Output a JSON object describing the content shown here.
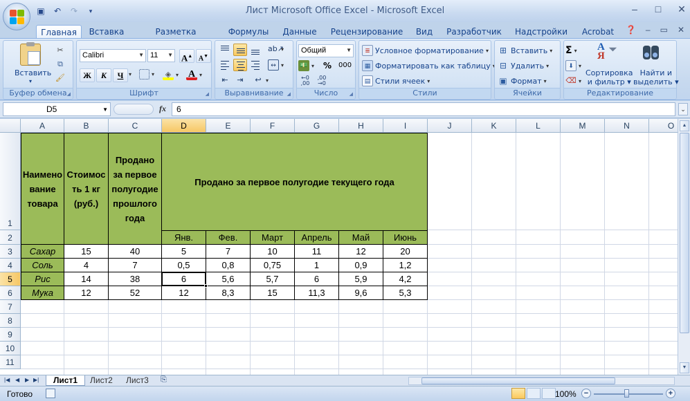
{
  "window": {
    "title": "Лист Microsoft Office Excel - Microsoft Excel",
    "controls": [
      "–",
      "□",
      "✕"
    ]
  },
  "quick_access": [
    {
      "icon": "save-icon",
      "glyph": "💾"
    },
    {
      "icon": "undo-icon",
      "glyph": "↶"
    },
    {
      "icon": "redo-icon",
      "glyph": "↷"
    },
    {
      "icon": "customize-qat-icon",
      "glyph": "▾"
    }
  ],
  "tabs": [
    "Главная",
    "Вставка",
    "Разметка страницы",
    "Формулы",
    "Данные",
    "Рецензирование",
    "Вид",
    "Разработчик",
    "Надстройки",
    "Acrobat"
  ],
  "active_tab": "Главная",
  "ribbon": {
    "clipboard": {
      "label": "Буфер обмена",
      "paste": "Вставить"
    },
    "font": {
      "label": "Шрифт",
      "font_name": "Calibri",
      "font_size": "11",
      "bold": "Ж",
      "italic": "К",
      "underline": "Ч",
      "grow": "A",
      "shrink": "A"
    },
    "alignment": {
      "label": "Выравнивание"
    },
    "number": {
      "label": "Число",
      "format": "Общий",
      "percent": "%",
      "thousands": "000"
    },
    "styles": {
      "label": "Стили",
      "conditional": "Условное форматирование",
      "as_table": "Форматировать как таблицу",
      "cell_styles": "Стили ячеек"
    },
    "cells": {
      "label": "Ячейки",
      "insert": "Вставить",
      "delete": "Удалить",
      "format": "Формат"
    },
    "editing": {
      "label": "Редактирование",
      "sigma": "Σ",
      "sort1": "Сортировка",
      "sort2": "и фильтр",
      "find1": "Найти и",
      "find2": "выделить"
    }
  },
  "formula_bar": {
    "name_box": "D5",
    "fx": "fx",
    "value": "6"
  },
  "columns": [
    "A",
    "B",
    "C",
    "D",
    "E",
    "F",
    "G",
    "H",
    "I",
    "J",
    "K",
    "L",
    "M",
    "N",
    "O"
  ],
  "rows": [
    "1",
    "2",
    "3",
    "4",
    "5",
    "6",
    "7",
    "8",
    "9",
    "10",
    "11"
  ],
  "selected_cell": {
    "col": "D",
    "row": "5"
  },
  "table": {
    "header_a": "Наименование товара",
    "header_a_lines": [
      "Наимено",
      "вание",
      "товара"
    ],
    "header_b_lines": [
      "Стоимос",
      "ть 1 кг",
      "(руб.)"
    ],
    "header_c_lines": [
      "Продано",
      "за первое",
      "полугодие",
      "прошлого",
      "года"
    ],
    "header_merged": "Продано за первое полугодие текущего года",
    "months": [
      "Янв.",
      "Фев.",
      "Март",
      "Апрель",
      "Май",
      "Июнь"
    ],
    "data": [
      {
        "name": "Сахар",
        "price": "15",
        "prev": "40",
        "months": [
          "5",
          "7",
          "10",
          "11",
          "12",
          "20"
        ]
      },
      {
        "name": "Соль",
        "price": "4",
        "prev": "7",
        "months": [
          "0,5",
          "0,8",
          "0,75",
          "1",
          "0,9",
          "1,2"
        ]
      },
      {
        "name": "Рис",
        "price": "14",
        "prev": "38",
        "months": [
          "6",
          "5,6",
          "5,7",
          "6",
          "5,9",
          "4,2"
        ]
      },
      {
        "name": "Мука",
        "price": "12",
        "prev": "52",
        "months": [
          "12",
          "8,3",
          "15",
          "11,3",
          "9,6",
          "5,3"
        ]
      }
    ]
  },
  "sheets": [
    "Лист1",
    "Лист2",
    "Лист3"
  ],
  "active_sheet": "Лист1",
  "status": {
    "text": "Готово",
    "zoom": "100%"
  },
  "colors": {
    "green_fill": "#9bbb59",
    "selection_header": "#f6c765"
  }
}
